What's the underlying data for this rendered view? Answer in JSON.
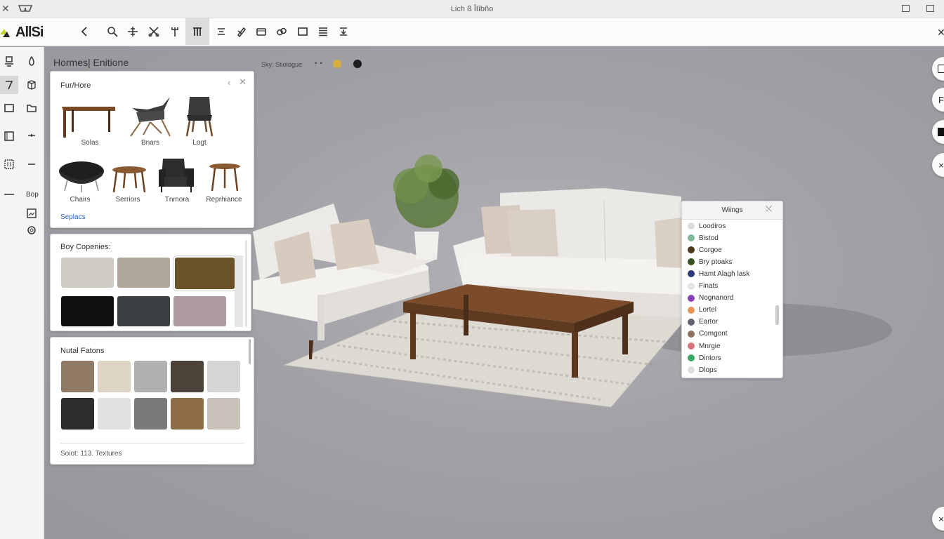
{
  "window": {
    "title": "Lich ß ÎIîbño"
  },
  "app": {
    "logo_text": "AllSi"
  },
  "viewport": {
    "title": "Hormes| Enitione",
    "scene_label": "Sky: Stiotogue",
    "scene_dots": "• •"
  },
  "rail": {
    "text_1": "Bop"
  },
  "furniture_panel": {
    "title": "Fur/Hore",
    "items": [
      {
        "label": "Solas"
      },
      {
        "label": "Bnars"
      },
      {
        "label": "Logt"
      },
      {
        "label": "Chairs"
      },
      {
        "label": "Serriors"
      },
      {
        "label": "Tnmora"
      },
      {
        "label": "Reprhiance"
      }
    ],
    "more_link": "Seplacs"
  },
  "fabric_panel": {
    "title": "Boy Copenies:",
    "swatches": [
      "#cdcbc2",
      "#b1a89b",
      "#6a5427",
      "#101010",
      "#3b3e43",
      "#ad9b9f"
    ]
  },
  "natural_panel": {
    "title": "Nutal Fatons",
    "swatches": [
      "#8f7a65",
      "#ddd4c6",
      "#b0b0b1",
      "#4b4238",
      "#d6d5d3",
      "#2c2c2c",
      "#e2e1df",
      "#7a797b",
      "#8c6d48",
      "#c8c2ba"
    ],
    "footer": "Soiot: 113. Textures"
  },
  "materials_panel": {
    "title": "Wiings",
    "items": [
      {
        "label": "Loodiros",
        "color": "#dcdcdc"
      },
      {
        "label": "Bistod",
        "color": "#7fb896"
      },
      {
        "label": "Corgoe",
        "color": "#4e3b1c"
      },
      {
        "label": "Bry ptoaks",
        "color": "#37501d"
      },
      {
        "label": "Hamt Alagh lask",
        "color": "#2b3a78"
      },
      {
        "label": "Finats",
        "color": "#e4e4e4"
      },
      {
        "label": "Nognanord",
        "color": "#8a3fba"
      },
      {
        "label": "Lortel",
        "color": "#e8935a"
      },
      {
        "label": "Eartor",
        "color": "#62646b"
      },
      {
        "label": "Comgont",
        "color": "#8d7060"
      },
      {
        "label": "Mnrgie",
        "color": "#d8737a"
      },
      {
        "label": "Dintors",
        "color": "#3ca867"
      },
      {
        "label": "Dlops",
        "color": "#dedede"
      }
    ]
  },
  "float_buttons": {
    "b1": "F",
    "b2": "×",
    "b3": "×"
  }
}
